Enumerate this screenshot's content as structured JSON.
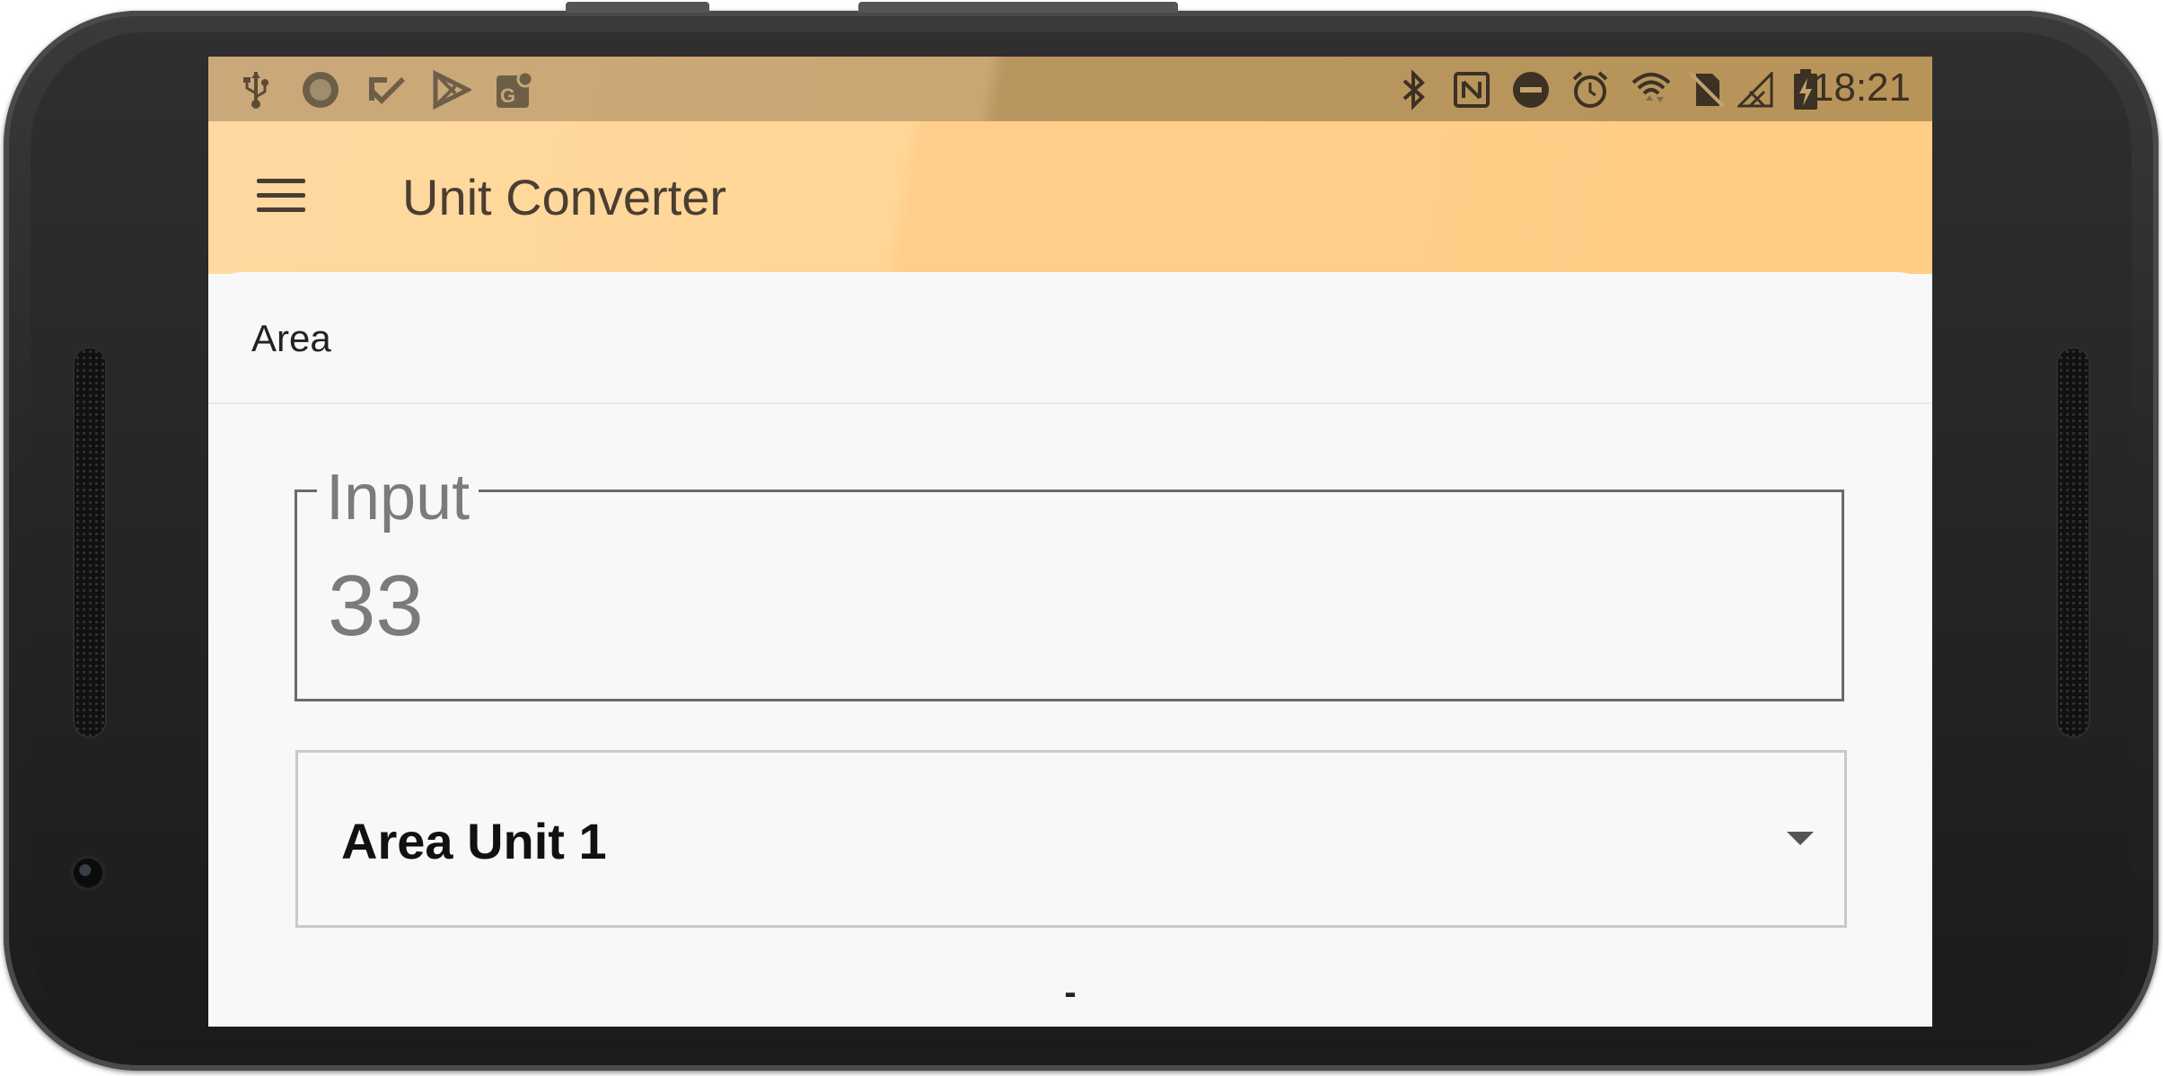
{
  "status_bar": {
    "time": "18:21",
    "left_icons": [
      "usb-icon",
      "circle-icon",
      "check-icon",
      "play-store-icon",
      "maps-icon"
    ],
    "right_icons": [
      "bluetooth-icon",
      "nfc-icon",
      "do-not-disturb-icon",
      "alarm-icon",
      "wifi-icon",
      "no-sim-icon",
      "signal-icon",
      "battery-charging-icon"
    ]
  },
  "app_bar": {
    "title": "Unit Converter",
    "menu_icon": "hamburger-menu-icon"
  },
  "section": {
    "title": "Area"
  },
  "input": {
    "label": "Input",
    "value": "33"
  },
  "unit_select": {
    "selected": "Area Unit 1"
  },
  "result": {
    "text": "-"
  },
  "colors": {
    "status_bar": "#c9a774",
    "app_bar": "#ffd696",
    "card": "#f8f8f8",
    "title_text": "#4a3e33"
  }
}
